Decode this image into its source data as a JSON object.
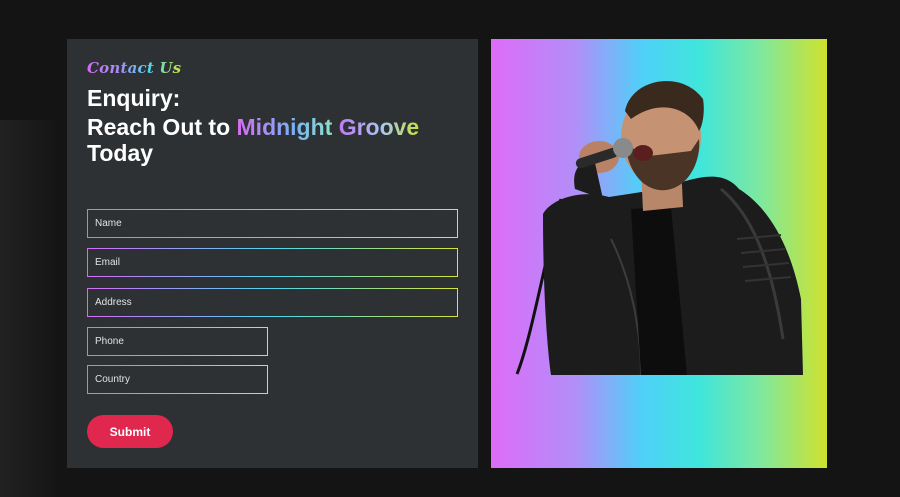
{
  "form": {
    "eyebrow": "Contact Us",
    "heading_line1": "Enquiry:",
    "heading_prefix": "Reach Out to ",
    "brand_word1": "Midnight",
    "brand_word2": "Groove",
    "heading_suffix": "Today",
    "fields": {
      "name_placeholder": "Name",
      "email_placeholder": "Email",
      "address_placeholder": "Address",
      "phone_placeholder": "Phone",
      "country_placeholder": "Country"
    },
    "submit_label": "Submit"
  },
  "image": {
    "subject": "singer-with-microphone-photo"
  },
  "colors": {
    "page_background": "#141414",
    "panel_background": "#2e3133",
    "submit_button": "#e0284f",
    "gradient": [
      "#dd6cf8",
      "#4fd0f8",
      "#3fe6dc",
      "#cfe22c"
    ]
  }
}
